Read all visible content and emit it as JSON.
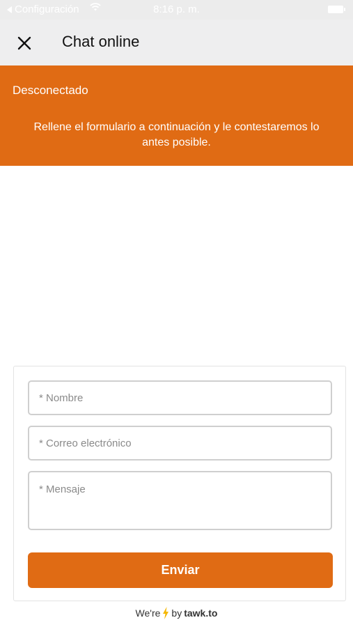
{
  "statusbar": {
    "back_label": "Configuración",
    "time": "8:16 p. m."
  },
  "navbar": {
    "title": "Chat online"
  },
  "banner": {
    "status": "Desconectado",
    "message": "Rellene el formulario a continuación y le contestaremos lo antes posible."
  },
  "form": {
    "name_placeholder": "* Nombre",
    "email_placeholder": "* Correo electrónico",
    "message_placeholder": "* Mensaje",
    "submit_label": "Enviar"
  },
  "footer": {
    "prefix": "We're",
    "by": "by",
    "brand": "tawk.to"
  },
  "colors": {
    "accent": "#e06b14",
    "bolt": "#f5b700"
  }
}
